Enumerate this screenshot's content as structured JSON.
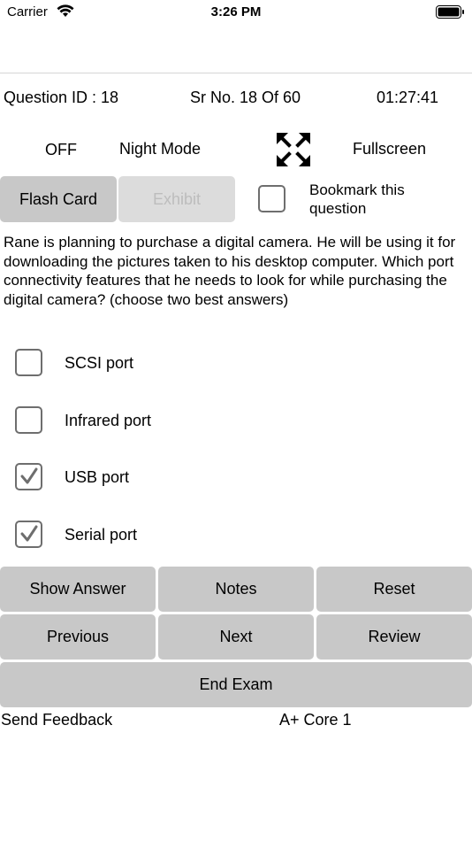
{
  "status_bar": {
    "carrier": "Carrier",
    "time": "3:26 PM"
  },
  "info": {
    "question_id": "Question ID : 18",
    "sr_no": "Sr No. 18 Of 60",
    "timer": "01:27:41"
  },
  "mode": {
    "night_state": "OFF",
    "night_label": "Night Mode",
    "fullscreen_label": "Fullscreen"
  },
  "toolbar": {
    "flash_card": "Flash Card",
    "exhibit": "Exhibit",
    "bookmark": "Bookmark this question",
    "bookmarked": false
  },
  "question": {
    "text": "Rane is planning to purchase a digital camera. He will be using it for downloading the pictures taken to his desktop computer. Which port connectivity features that he needs to look for while purchasing the digital camera? (choose two best answers)"
  },
  "options": [
    {
      "label": "SCSI port",
      "checked": false
    },
    {
      "label": "Infrared port",
      "checked": false
    },
    {
      "label": "USB port",
      "checked": true
    },
    {
      "label": "Serial port",
      "checked": true
    }
  ],
  "actions": {
    "show_answer": "Show Answer",
    "notes": "Notes",
    "reset": "Reset",
    "previous": "Previous",
    "next": "Next",
    "review": "Review",
    "end_exam": "End Exam"
  },
  "footer": {
    "send_feedback": "Send Feedback",
    "exam_name": "A+ Core 1"
  },
  "colors": {
    "button_bg": "#c8c8c8",
    "disabled_text": "#bdbdbd",
    "checkbox_border": "#6e6e6e"
  }
}
